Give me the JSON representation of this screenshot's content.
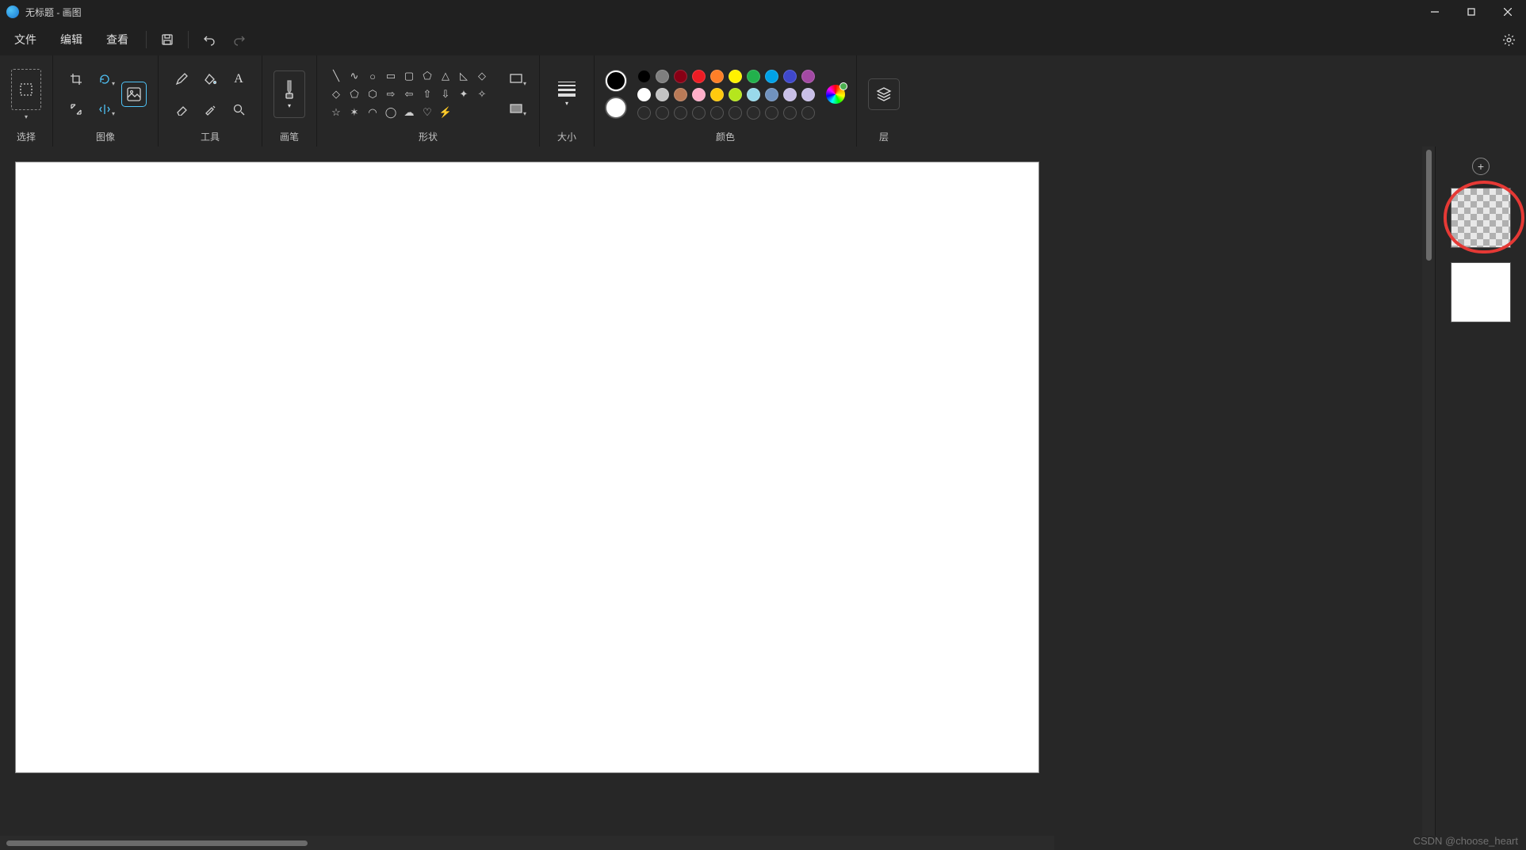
{
  "titlebar": {
    "title": "无标题 - 画图"
  },
  "menu": {
    "file": "文件",
    "edit": "编辑",
    "view": "查看"
  },
  "ribbon": {
    "select_label": "选择",
    "image_label": "图像",
    "tools_label": "工具",
    "brushes_label": "画笔",
    "shapes_label": "形状",
    "size_label": "大小",
    "colors_label": "颜色",
    "layers_label": "层"
  },
  "colors": {
    "primary": "#000000",
    "secondary": "#ffffff",
    "row1": [
      "#000000",
      "#7f7f7f",
      "#880015",
      "#ed1c24",
      "#ff7f27",
      "#fff200",
      "#22b14c",
      "#00a2e8",
      "#3f48cc",
      "#a349a4"
    ],
    "row2": [
      "#ffffff",
      "#c3c3c3",
      "#b97a57",
      "#ffaec9",
      "#ffc90e",
      "#b5e61d",
      "#99d9ea",
      "#7092be",
      "#c8bfe7",
      "#c8bfe7"
    ]
  },
  "watermark": "CSDN @choose_heart"
}
